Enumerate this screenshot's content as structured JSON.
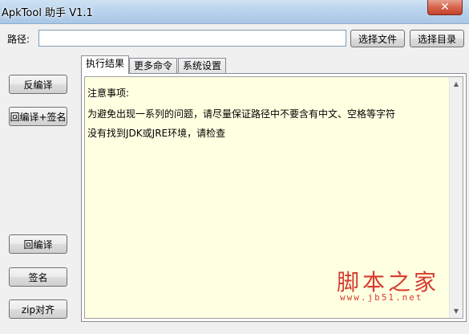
{
  "window": {
    "title": "ApkTool 助手 V1.1",
    "close_glyph": "✕"
  },
  "path_row": {
    "label": "路径:",
    "value": "",
    "choose_file": "选择文件",
    "choose_dir": "选择目录"
  },
  "left_buttons": {
    "decompile": "反编译",
    "recompile_sign": "回编译+签名",
    "recompile": "回编译",
    "sign": "签名",
    "zipalign": "zip对齐"
  },
  "tabs": [
    {
      "label": "执行结果",
      "active": true
    },
    {
      "label": "更多命令",
      "active": false
    },
    {
      "label": "系统设置",
      "active": false
    }
  ],
  "output": {
    "lines": [
      "注意事项:",
      "为避免出现一系列的问题，请尽量保证路径中不要含有中文、空格等字符",
      "没有找到JDK或JRE环境，请检查"
    ]
  },
  "watermark": {
    "main": "脚本之家",
    "sub": "www.jb51.net"
  }
}
